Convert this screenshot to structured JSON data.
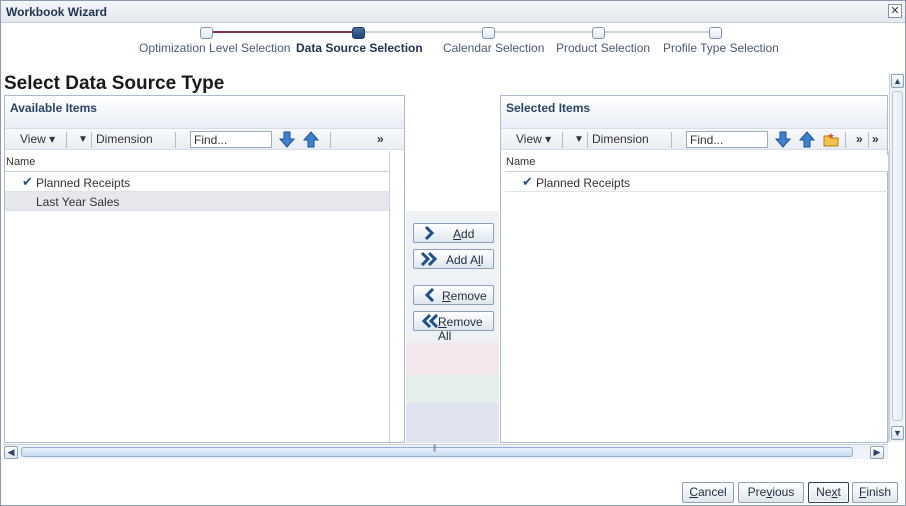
{
  "window": {
    "title": "Workbook Wizard",
    "close_label": "✕"
  },
  "train": {
    "steps": [
      {
        "label": "Optimization Level Selection",
        "state": "done"
      },
      {
        "label": "Data Source Selection",
        "state": "current"
      },
      {
        "label": "Calendar Selection",
        "state": "pending"
      },
      {
        "label": "Product Selection",
        "state": "pending"
      },
      {
        "label": "Profile Type Selection",
        "state": "pending"
      }
    ]
  },
  "page": {
    "title": "Select Data Source Type"
  },
  "available": {
    "title": "Available Items",
    "toolbar": {
      "view": "View",
      "dimension": "Dimension",
      "find_value": "Find..."
    },
    "column": "Name",
    "rows": [
      {
        "label": "Planned Receipts",
        "checked": true
      },
      {
        "label": "Last Year Sales",
        "checked": false
      }
    ]
  },
  "selected": {
    "title": "Selected Items",
    "toolbar": {
      "view": "View",
      "dimension": "Dimension",
      "find_value": "Find..."
    },
    "column": "Name",
    "rows": [
      {
        "label": "Planned Receipts",
        "checked": true
      }
    ]
  },
  "shuttle": {
    "add_pre": "",
    "add_u": "A",
    "add_post": "dd",
    "addall_pre": "Add A",
    "addall_u": "l",
    "addall_post": "l",
    "remove_pre": "",
    "remove_u": "R",
    "remove_post": "emove",
    "removeall_pre": "",
    "removeall_u": "R",
    "removeall_post": "emove All"
  },
  "footer": {
    "cancel_pre": "",
    "cancel_u": "C",
    "cancel_post": "ancel",
    "previous_pre": "Pre",
    "previous_u": "v",
    "previous_post": "ious",
    "next_pre": "Ne",
    "next_u": "x",
    "next_post": "t",
    "finish_pre": "",
    "finish_u": "F",
    "finish_post": "inish"
  },
  "colors": {
    "accent": "#1f4574",
    "train_done": "#8b3050",
    "header_text": "#2a4466"
  }
}
